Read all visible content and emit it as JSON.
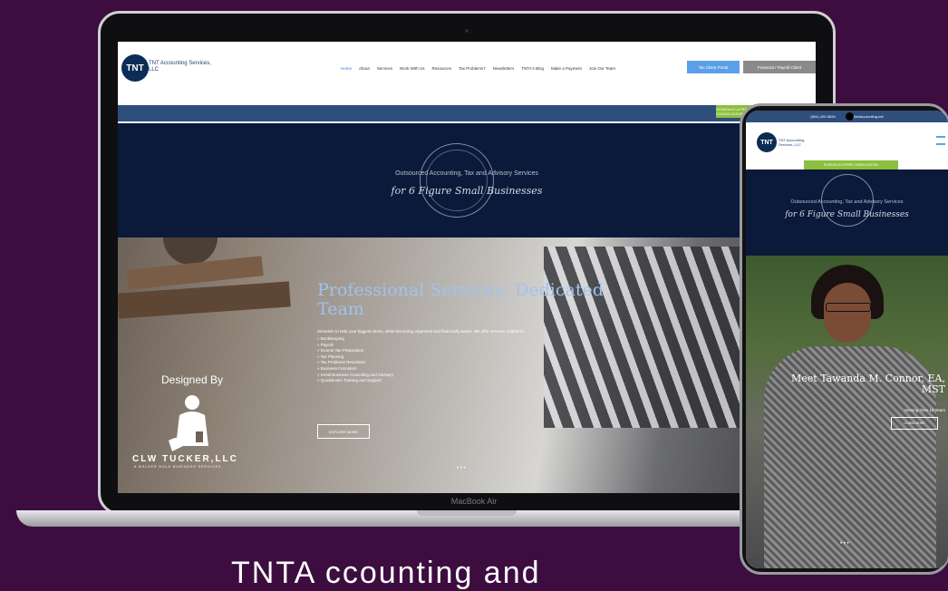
{
  "laptop": {
    "model_label": "MacBook Air",
    "site": {
      "logo_initials": "TNT",
      "logo_text": "TNT Accounting Services, LLC",
      "nav": [
        "Home",
        "About",
        "Services",
        "Work With Us",
        "Resources",
        "Tax Problems?",
        "Newsletters",
        "TNTA's Blog",
        "Make a Payment",
        "Join Our Team"
      ],
      "portal_button": "Tax Client Portal",
      "schedule_button": "Financial / Payroll Client",
      "promo_pill": "SCHEDULE A FREE CONSULTATION",
      "banner_tagline": "Outsourced Accounting, Tax and Advisory Services",
      "banner_script": "for 6 Figure Small Businesses",
      "hero_title": "Professional Services, Dedicated Team",
      "hero_subtext": "Schedule to help your biggest stress, while becoming organized and financially aware. We offer services related to:",
      "hero_list": [
        "» Bookkeeping",
        "» Payroll",
        "» Income Tax Preparation",
        "» Tax Planning",
        "» Tax Problems Resolution",
        "» Business Formation",
        "» Small Business Consulting and Advisory",
        "» QuickBooks Training and Support"
      ],
      "explore_button": "EXPLORE MORE",
      "slider_dots": "• • •"
    },
    "credit": {
      "designed_by": "Designed By",
      "company": "CLW TUCKER,LLC",
      "company_tagline": "A BOLDER BOLD BUSINESS SERVICES"
    }
  },
  "phone": {
    "status_phone": "(804) 420-9834",
    "status_email": "info@tntaccounting.net",
    "logo_initials": "TNT",
    "logo_text": "TNT Accounting Services, LLC",
    "promo_pill": "SCHEDULE A FREE CONSULTATION",
    "banner_tagline": "Outsourced Accounting, Tax and Advisory Services",
    "banner_script": "for 6 Figure Small Businesses",
    "meet_title": "Meet Tawanda M. Connor, EA, MST",
    "serving_text": "Serving Over 15 Years",
    "learn_button": "LEARN MORE",
    "slider_dots": "• • •"
  },
  "caption": "TNTA   ccounting   and"
}
